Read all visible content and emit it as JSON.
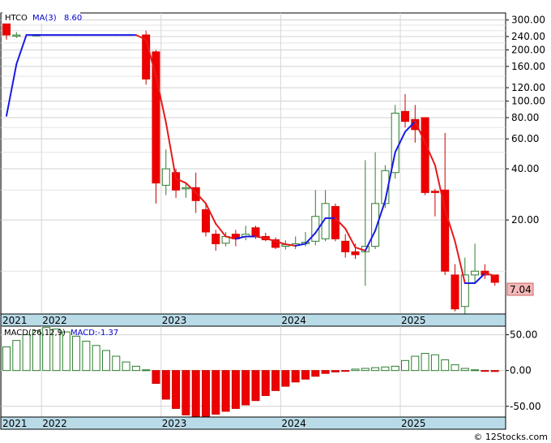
{
  "chart_data": [
    {
      "type": "candlestick",
      "title": "(HTCO)",
      "scale": "log",
      "ylim": [
        5.6,
        330
      ],
      "grid": true,
      "legend_position": "top-left",
      "legend": {
        "symbol": "HTCO",
        "ma_label": "MA(3)",
        "ma_value": "8.60"
      },
      "last_price": "7.04",
      "yticks": [
        {
          "v": 300,
          "label": "300.00"
        },
        {
          "v": 240,
          "label": "240.00"
        },
        {
          "v": 200,
          "label": "200.00"
        },
        {
          "v": 160,
          "label": "160.00"
        },
        {
          "v": 120,
          "label": "120.00"
        },
        {
          "v": 100,
          "label": "100.00"
        },
        {
          "v": 80,
          "label": "80.00"
        },
        {
          "v": 60,
          "label": "60.00"
        },
        {
          "v": 40,
          "label": "40.00"
        },
        {
          "v": 20,
          "label": "20.00"
        }
      ],
      "extra_gridlines": [
        280,
        260,
        220,
        180,
        140,
        90,
        70,
        50,
        30,
        10
      ],
      "x_labels": [
        {
          "label": "2021",
          "i": 0
        },
        {
          "label": "2022",
          "i": 4
        },
        {
          "label": "2023",
          "i": 16
        },
        {
          "label": "2024",
          "i": 28
        },
        {
          "label": "2025",
          "i": 40
        }
      ],
      "candles": [
        {
          "i": 0,
          "o": 300,
          "h": 300,
          "l": 230,
          "c": 245
        },
        {
          "i": 1,
          "o": 245,
          "h": 255,
          "l": 235,
          "c": 245
        },
        {
          "i": 3,
          "o": 245,
          "h": 248,
          "l": 244,
          "c": 246
        },
        {
          "i": 14,
          "o": 245,
          "h": 260,
          "l": 125,
          "c": 135
        },
        {
          "i": 15,
          "o": 195,
          "h": 200,
          "l": 25,
          "c": 33
        },
        {
          "i": 16,
          "o": 32,
          "h": 52,
          "l": 28,
          "c": 40
        },
        {
          "i": 17,
          "o": 38,
          "h": 40,
          "l": 27,
          "c": 30
        },
        {
          "i": 18,
          "o": 31,
          "h": 33,
          "l": 27,
          "c": 31
        },
        {
          "i": 19,
          "o": 31,
          "h": 38,
          "l": 22,
          "c": 26
        },
        {
          "i": 20,
          "o": 23,
          "h": 25,
          "l": 16,
          "c": 17
        },
        {
          "i": 21,
          "o": 16.5,
          "h": 17.5,
          "l": 13.2,
          "c": 14.5
        },
        {
          "i": 22,
          "o": 14.6,
          "h": 17,
          "l": 14,
          "c": 16
        },
        {
          "i": 23,
          "o": 16.5,
          "h": 17.5,
          "l": 14,
          "c": 15.5
        },
        {
          "i": 24,
          "o": 16,
          "h": 18.5,
          "l": 15.2,
          "c": 16.5
        },
        {
          "i": 25,
          "o": 18,
          "h": 18.5,
          "l": 15.5,
          "c": 16
        },
        {
          "i": 26,
          "o": 16,
          "h": 16.8,
          "l": 15,
          "c": 15.3
        },
        {
          "i": 27,
          "o": 15.3,
          "h": 15.8,
          "l": 13.5,
          "c": 13.8
        },
        {
          "i": 28,
          "o": 14,
          "h": 15.2,
          "l": 13.4,
          "c": 14.3
        },
        {
          "i": 29,
          "o": 14.2,
          "h": 16,
          "l": 13.5,
          "c": 14.5
        },
        {
          "i": 30,
          "o": 14.5,
          "h": 17,
          "l": 14,
          "c": 14.8
        },
        {
          "i": 31,
          "o": 15,
          "h": 30,
          "l": 14.2,
          "c": 21
        },
        {
          "i": 32,
          "o": 15.5,
          "h": 30,
          "l": 15,
          "c": 25
        },
        {
          "i": 33,
          "o": 24,
          "h": 25,
          "l": 15,
          "c": 15.5
        },
        {
          "i": 34,
          "o": 15,
          "h": 16.5,
          "l": 12,
          "c": 13
        },
        {
          "i": 35,
          "o": 13,
          "h": 14.5,
          "l": 11.8,
          "c": 12.5
        },
        {
          "i": 36,
          "o": 13,
          "h": 45,
          "l": 8.2,
          "c": 14
        },
        {
          "i": 37,
          "o": 14,
          "h": 50,
          "l": 13.5,
          "c": 25
        },
        {
          "i": 38,
          "o": 25,
          "h": 42,
          "l": 23.5,
          "c": 39
        },
        {
          "i": 39,
          "o": 38,
          "h": 95,
          "l": 35,
          "c": 85
        },
        {
          "i": 40,
          "o": 87,
          "h": 110,
          "l": 70,
          "c": 76
        },
        {
          "i": 41,
          "o": 78,
          "h": 95,
          "l": 57,
          "c": 68
        },
        {
          "i": 42,
          "o": 80,
          "h": 80,
          "l": 28,
          "c": 29
        },
        {
          "i": 43,
          "o": 29.5,
          "h": 30.5,
          "l": 21,
          "c": 29
        },
        {
          "i": 44,
          "o": 30,
          "h": 65,
          "l": 9.5,
          "c": 10
        },
        {
          "i": 45,
          "o": 9.5,
          "h": 11,
          "l": 5.8,
          "c": 6
        },
        {
          "i": 46,
          "o": 6.2,
          "h": 12,
          "l": 5.6,
          "c": 9.5
        },
        {
          "i": 47,
          "o": 9.5,
          "h": 14.5,
          "l": 8.5,
          "c": 10
        },
        {
          "i": 48,
          "o": 10,
          "h": 11,
          "l": 9,
          "c": 9.5
        },
        {
          "i": 49,
          "o": 9.5,
          "h": 9.5,
          "l": 8.2,
          "c": 8.6
        }
      ],
      "ma_line": [
        {
          "i": 0,
          "v": 82
        },
        {
          "i": 1,
          "v": 165
        },
        {
          "i": 2,
          "v": 245
        },
        {
          "i": 3,
          "v": 245
        },
        {
          "i": 4,
          "v": 245
        },
        {
          "i": 5,
          "v": 245
        },
        {
          "i": 6,
          "v": 245
        },
        {
          "i": 7,
          "v": 245
        },
        {
          "i": 8,
          "v": 245
        },
        {
          "i": 9,
          "v": 245
        },
        {
          "i": 10,
          "v": 245
        },
        {
          "i": 11,
          "v": 245
        },
        {
          "i": 12,
          "v": 245
        },
        {
          "i": 13,
          "v": 245
        },
        {
          "i": 14,
          "v": 230
        },
        {
          "i": 15,
          "v": 140
        },
        {
          "i": 16,
          "v": 75
        },
        {
          "i": 17,
          "v": 35
        },
        {
          "i": 18,
          "v": 33
        },
        {
          "i": 19,
          "v": 29
        },
        {
          "i": 20,
          "v": 25
        },
        {
          "i": 21,
          "v": 19
        },
        {
          "i": 22,
          "v": 16
        },
        {
          "i": 23,
          "v": 15.5
        },
        {
          "i": 24,
          "v": 16
        },
        {
          "i": 25,
          "v": 16
        },
        {
          "i": 26,
          "v": 15.6
        },
        {
          "i": 27,
          "v": 15
        },
        {
          "i": 28,
          "v": 14.4
        },
        {
          "i": 29,
          "v": 14.1
        },
        {
          "i": 30,
          "v": 14.5
        },
        {
          "i": 31,
          "v": 16.8
        },
        {
          "i": 32,
          "v": 20.5
        },
        {
          "i": 33,
          "v": 20.5
        },
        {
          "i": 34,
          "v": 17.8
        },
        {
          "i": 35,
          "v": 13.8
        },
        {
          "i": 36,
          "v": 13.2
        },
        {
          "i": 37,
          "v": 17.3
        },
        {
          "i": 38,
          "v": 26
        },
        {
          "i": 39,
          "v": 50
        },
        {
          "i": 40,
          "v": 66
        },
        {
          "i": 41,
          "v": 76
        },
        {
          "i": 42,
          "v": 57
        },
        {
          "i": 43,
          "v": 42
        },
        {
          "i": 44,
          "v": 23
        },
        {
          "i": 45,
          "v": 15
        },
        {
          "i": 46,
          "v": 8.5
        },
        {
          "i": 47,
          "v": 8.5
        },
        {
          "i": 48,
          "v": 9.7
        },
        {
          "i": 49,
          "v": 9.4
        }
      ]
    },
    {
      "type": "bar",
      "title": "MACD(26,12,9)",
      "label": "MACD:-1.37",
      "ylim": [
        -65,
        62
      ],
      "yticks": [
        {
          "v": 50,
          "label": "50.00"
        },
        {
          "v": 0,
          "label": "0.00"
        },
        {
          "v": -50,
          "label": "-50.00"
        }
      ],
      "x_labels": [
        {
          "label": "2021",
          "i": 0
        },
        {
          "label": "2022",
          "i": 4
        },
        {
          "label": "2023",
          "i": 16
        },
        {
          "label": "2024",
          "i": 28
        },
        {
          "label": "2025",
          "i": 40
        }
      ],
      "values": [
        33,
        42,
        50,
        56,
        60,
        58,
        54,
        48,
        41,
        35,
        28,
        20,
        12,
        6,
        1,
        -18,
        -40,
        -53,
        -62,
        -64,
        -64,
        -61,
        -57,
        -53,
        -48,
        -42,
        -35,
        -28,
        -22,
        -16,
        -12,
        -8,
        -4,
        -2,
        -1,
        2,
        3,
        4,
        5,
        6,
        14,
        20,
        24,
        22,
        15,
        8,
        3,
        1,
        -1,
        -1.37
      ]
    }
  ],
  "watermark": "© 12Stocks.com"
}
